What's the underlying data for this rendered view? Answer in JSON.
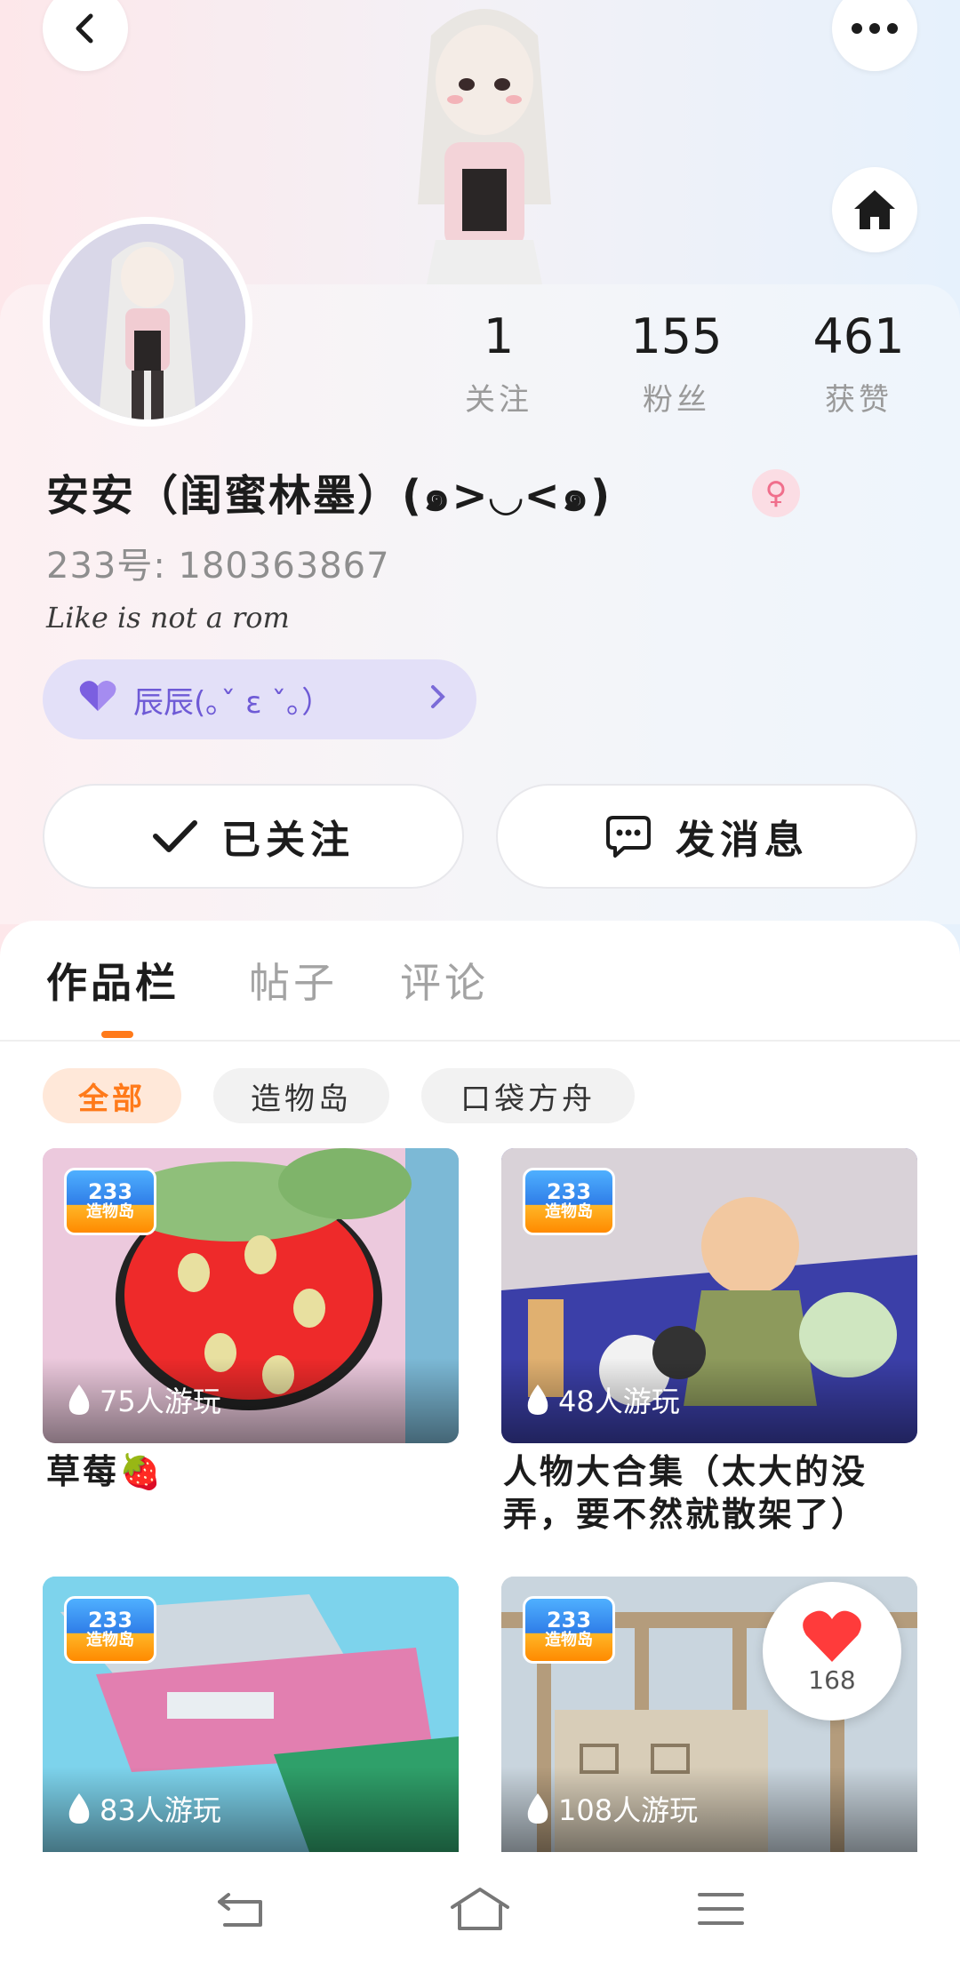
{
  "profile": {
    "nickname": "安安（闺蜜林墨）(๑>◡<๑)",
    "gender_symbol": "♀",
    "id_line": "233号: 180363867",
    "signature": "Like is not a rom",
    "cp_label": "辰辰(｡ˇ ε ˇ｡）"
  },
  "stats": [
    {
      "value": "1",
      "label": "关注"
    },
    {
      "value": "155",
      "label": "粉丝"
    },
    {
      "value": "461",
      "label": "获赞"
    }
  ],
  "actions": {
    "follow_label": "已关注",
    "message_label": "发消息"
  },
  "tabs": {
    "works": "作品栏",
    "posts": "帖子",
    "comments": "评论"
  },
  "chips": {
    "all": "全部",
    "island": "造物岛",
    "ark": "口袋方舟"
  },
  "logo": {
    "line1": "233",
    "line2": "造物岛"
  },
  "works": [
    {
      "title": "草莓🍓",
      "plays": "75人游玩"
    },
    {
      "title": "人物大合集（太大的没弄，要不然就散架了）",
      "plays": "48人游玩"
    },
    {
      "title": "",
      "plays": "83人游玩"
    },
    {
      "title": "",
      "plays": "108人游玩"
    }
  ],
  "like_widget": {
    "count": "168"
  },
  "colors": {
    "accent": "#ff7a1a",
    "cp": "#6e5ad6"
  }
}
